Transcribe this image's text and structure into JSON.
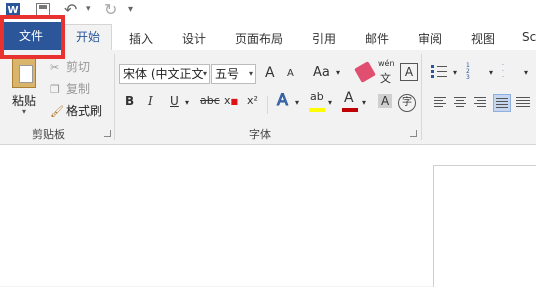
{
  "qat": {
    "app_icon": "W"
  },
  "tabs": [
    {
      "label": "文件"
    },
    {
      "label": "开始"
    },
    {
      "label": "插入"
    },
    {
      "label": "设计"
    },
    {
      "label": "页面布局"
    },
    {
      "label": "引用"
    },
    {
      "label": "邮件"
    },
    {
      "label": "审阅"
    },
    {
      "label": "视图"
    },
    {
      "label": "Sc"
    }
  ],
  "clipboard": {
    "paste_label": "粘贴",
    "cut_label": "剪切",
    "copy_label": "复制",
    "format_painter_label": "格式刷",
    "group_label": "剪贴板"
  },
  "font": {
    "font_name": "宋体 (中文正文",
    "font_size": "五号",
    "grow": "A",
    "shrink": "A",
    "aa": "Aa",
    "pinyin_top": "wén",
    "pinyin_bottom": "文",
    "char_border": "A",
    "bold": "B",
    "italic": "I",
    "underline": "U",
    "strike": "abc",
    "subscript": "x",
    "superscript": "x²",
    "text_effect": "A",
    "highlight": "ab",
    "font_color": "A",
    "char_shading": "A",
    "enclose": "字",
    "group_label": "字体"
  },
  "colors": {
    "file_tab": "#2b579a",
    "highlight_box": "#e8322f",
    "font_color_bar": "#c00000",
    "highlight_bar": "#ffff00"
  }
}
